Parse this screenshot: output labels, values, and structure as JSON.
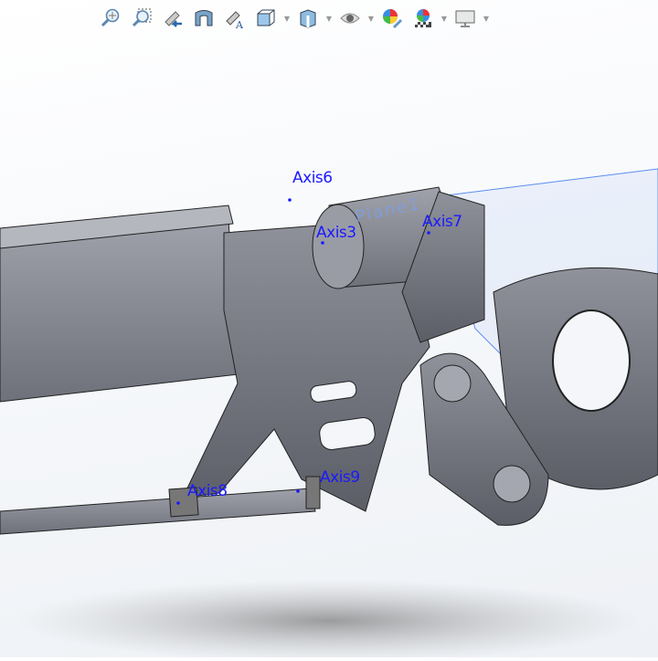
{
  "toolbar": {
    "items": [
      {
        "icon": "zoom-to-fit-icon",
        "dropdown": false
      },
      {
        "icon": "zoom-to-area-icon",
        "dropdown": false
      },
      {
        "icon": "previous-view-icon",
        "dropdown": false
      },
      {
        "icon": "section-view-icon",
        "dropdown": false
      },
      {
        "icon": "dynamic-annotation-views-icon",
        "dropdown": false
      },
      {
        "icon": "view-orientation-icon",
        "dropdown": true
      },
      {
        "icon": "display-style-icon",
        "dropdown": true
      },
      {
        "icon": "hide-show-items-icon",
        "dropdown": true
      },
      {
        "icon": "edit-appearance-icon",
        "dropdown": false
      },
      {
        "icon": "apply-scene-icon",
        "dropdown": true
      },
      {
        "icon": "view-settings-icon",
        "dropdown": true
      }
    ]
  },
  "model": {
    "labels": {
      "axis6": "Axis6",
      "axis3": "Axis3",
      "axis7": "Axis7",
      "axis8": "Axis8",
      "axis9": "Axis9",
      "plane1": "Plane1"
    },
    "colors": {
      "axis": "#1a1aff",
      "plane": "#5b8def",
      "body": "#8a8c96"
    }
  }
}
